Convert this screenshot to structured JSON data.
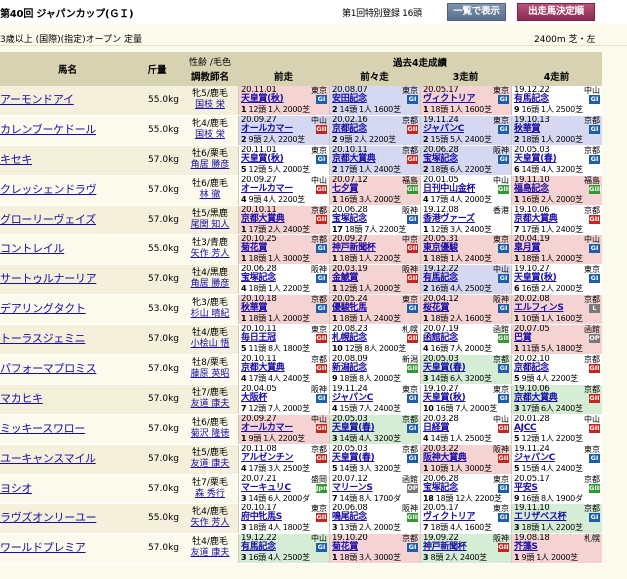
{
  "header": {
    "title": "第40回 ジャパンカップ(ＧＩ)",
    "registration": "第1回特別登録 16頭",
    "btn_list": "一覧で表示",
    "btn_entry": "出走馬決定順"
  },
  "conditions": "3歳以上 (国際)(指定)オープン 定量",
  "distance": "2400m 芝・左",
  "columns": {
    "name": "馬名",
    "weight": "斤量",
    "sex": "性齢 /毛色",
    "trainer": "調教師名",
    "past_header": "過去4走成績",
    "r1": "前走",
    "r2": "前々走",
    "r3": "3走前",
    "r4": "4走前"
  },
  "horses": [
    {
      "name": "アーモンドアイ",
      "weight": "55.0kg",
      "sex": "牝5/鹿毛",
      "trainer": "国枝 栄",
      "races": [
        {
          "date": "20.11.01",
          "venue": "東京",
          "race": "天皇賞(秋)",
          "grade": "GI",
          "gc": "1",
          "bg": "p",
          "info": "12頭 1人 2000芝",
          "pos": "1"
        },
        {
          "date": "20.08.07",
          "venue": "東京",
          "race": "安田記念",
          "grade": "GI",
          "gc": "1",
          "bg": "b",
          "info": "14頭 1人 1600芝",
          "pos": "2"
        },
        {
          "date": "20.05.17",
          "venue": "東京",
          "race": "ヴィクトリア",
          "grade": "GI",
          "gc": "1",
          "bg": "p",
          "info": "18頭 1人 1600芝",
          "pos": "1"
        },
        {
          "date": "19.12.22",
          "venue": "中山",
          "race": "有馬記念",
          "grade": "GI",
          "gc": "1",
          "bg": "w",
          "info": "16頭 1人 2500芝",
          "pos": "9"
        }
      ]
    },
    {
      "name": "カレンブーケドール",
      "weight": "55.0kg",
      "sex": "牝4/鹿毛",
      "trainer": "国枝 栄",
      "races": [
        {
          "date": "20.09.27",
          "venue": "中山",
          "race": "オールカマー",
          "grade": "GII",
          "gc": "2",
          "bg": "b",
          "info": "9頭 2人 2200芝",
          "pos": "2"
        },
        {
          "date": "20.02.16",
          "venue": "京都",
          "race": "京都記念",
          "grade": "GII",
          "gc": "2",
          "bg": "b",
          "info": "9頭 2人 2200芝",
          "pos": "2"
        },
        {
          "date": "19.11.24",
          "venue": "東京",
          "race": "ジャパンC",
          "grade": "GI",
          "gc": "1",
          "bg": "b",
          "info": "15頭 5人 2400芝",
          "pos": "2"
        },
        {
          "date": "19.10.13",
          "venue": "京都",
          "race": "秋華賞",
          "grade": "GI",
          "gc": "1",
          "bg": "b",
          "info": "18頭 1人 2000芝",
          "pos": "2"
        }
      ]
    },
    {
      "name": "キセキ",
      "weight": "57.0kg",
      "sex": "牡6/栗毛",
      "trainer": "角居 勝彦",
      "races": [
        {
          "date": "20.11.01",
          "venue": "東京",
          "race": "天皇賞(秋)",
          "grade": "GI",
          "gc": "1",
          "bg": "w",
          "info": "12頭 5人 2000芝",
          "pos": "5"
        },
        {
          "date": "20.10.11",
          "venue": "京都",
          "race": "京都大賞典",
          "grade": "GII",
          "gc": "2",
          "bg": "b",
          "info": "17頭 1人 2400芝",
          "pos": "2"
        },
        {
          "date": "20.06.28",
          "venue": "阪神",
          "race": "宝塚記念",
          "grade": "GI",
          "gc": "1",
          "bg": "b",
          "info": "18頭 6人 2200芝",
          "pos": "2"
        },
        {
          "date": "20.05.03",
          "venue": "京都",
          "race": "天皇賞(春)",
          "grade": "GI",
          "gc": "1",
          "bg": "w",
          "info": "14頭 4人 3200芝",
          "pos": "6"
        }
      ]
    },
    {
      "name": "クレッシェンドラヴ",
      "weight": "57.0kg",
      "sex": "牡6/鹿毛",
      "trainer": "林 徹",
      "races": [
        {
          "date": "20.09.27",
          "venue": "中山",
          "race": "オールカマー",
          "grade": "GII",
          "gc": "2",
          "bg": "w",
          "info": "9頭 4人 2200芝",
          "pos": "4"
        },
        {
          "date": "20.07.12",
          "venue": "福島",
          "race": "七夕賞",
          "grade": "GIII",
          "gc": "3",
          "bg": "p",
          "info": "16頭 3人 2000芝",
          "pos": "1"
        },
        {
          "date": "20.01.05",
          "venue": "中山",
          "race": "日刊中山金杯",
          "grade": "GIII",
          "gc": "3",
          "bg": "w",
          "info": "17頭 4人 2000芝",
          "pos": "4"
        },
        {
          "date": "19.11.10",
          "venue": "福島",
          "race": "福島記念",
          "grade": "GIII",
          "gc": "3",
          "bg": "p",
          "info": "16頭 2人 2000芝",
          "pos": "1"
        }
      ]
    },
    {
      "name": "グローリーヴェイズ",
      "weight": "57.0kg",
      "sex": "牡5/黒鹿",
      "trainer": "尾関 知人",
      "races": [
        {
          "date": "20.10.11",
          "venue": "京都",
          "race": "京都大賞典",
          "grade": "GII",
          "gc": "2",
          "bg": "p",
          "info": "17頭 2人 2400芝",
          "pos": "1"
        },
        {
          "date": "20.06.28",
          "venue": "阪神",
          "race": "宝塚記念",
          "grade": "GI",
          "gc": "1",
          "bg": "w",
          "info": "18頭 7人 2200芝",
          "pos": "17"
        },
        {
          "date": "19.12.08",
          "venue": "香港",
          "race": "香港ヴァーズ",
          "grade": "",
          "gc": "",
          "bg": "w",
          "info": "12頭 3人 2400芝",
          "pos": "1"
        },
        {
          "date": "19.10.06",
          "venue": "京都",
          "race": "京都大賞典",
          "grade": "GII",
          "gc": "2",
          "bg": "w",
          "info": "17頭 1人 2400芝",
          "pos": "7"
        }
      ]
    },
    {
      "name": "コントレイル",
      "weight": "55.0kg",
      "sex": "牡3/青鹿",
      "trainer": "矢作 芳人",
      "races": [
        {
          "date": "20.10.25",
          "venue": "京都",
          "race": "菊花賞",
          "grade": "GI",
          "gc": "1",
          "bg": "p",
          "info": "18頭 1人 3000芝",
          "pos": "1"
        },
        {
          "date": "20.09.27",
          "venue": "中京",
          "race": "神戸新聞杯",
          "grade": "GII",
          "gc": "2",
          "bg": "p",
          "info": "18頭 1人 2200芝",
          "pos": "1"
        },
        {
          "date": "20.05.31",
          "venue": "東京",
          "race": "東京優駿",
          "grade": "GI",
          "gc": "1",
          "bg": "p",
          "info": "18頭 1人 2400芝",
          "pos": "1"
        },
        {
          "date": "20.04.19",
          "venue": "中山",
          "race": "皐月賞",
          "grade": "GI",
          "gc": "1",
          "bg": "p",
          "info": "18頭 1人 2000芝",
          "pos": "1"
        }
      ]
    },
    {
      "name": "サートゥルナーリア",
      "weight": "57.0kg",
      "sex": "牡4/黒鹿",
      "trainer": "角居 勝彦",
      "races": [
        {
          "date": "20.06.28",
          "venue": "阪神",
          "race": "宝塚記念",
          "grade": "GI",
          "gc": "1",
          "bg": "w",
          "info": "18頭 1人 2200芝",
          "pos": "4"
        },
        {
          "date": "20.03.19",
          "venue": "阪神",
          "race": "金鯱賞",
          "grade": "GII",
          "gc": "2",
          "bg": "p",
          "info": "12頭 1人 2000芝",
          "pos": "1"
        },
        {
          "date": "19.12.22",
          "venue": "中山",
          "race": "有馬記念",
          "grade": "GI",
          "gc": "1",
          "bg": "b",
          "info": "16頭 4人 2500芝",
          "pos": "2"
        },
        {
          "date": "19.10.27",
          "venue": "東京",
          "race": "天皇賞(秋)",
          "grade": "GI",
          "gc": "1",
          "bg": "w",
          "info": "16頭 2人 2000芝",
          "pos": "6"
        }
      ]
    },
    {
      "name": "デアリングタクト",
      "weight": "53.0kg",
      "sex": "牝3/鹿毛",
      "trainer": "杉山 晴紀",
      "races": [
        {
          "date": "20.10.18",
          "venue": "京都",
          "race": "秋華賞",
          "grade": "GI",
          "gc": "1",
          "bg": "p",
          "info": "18頭 1人 2000芝",
          "pos": "1"
        },
        {
          "date": "20.05.24",
          "venue": "東京",
          "race": "優駿牝馬",
          "grade": "GI",
          "gc": "1",
          "bg": "p",
          "info": "18頭 1人 2400芝",
          "pos": "1"
        },
        {
          "date": "20.04.12",
          "venue": "阪神",
          "race": "桜花賞",
          "grade": "GI",
          "gc": "1",
          "bg": "p",
          "info": "18頭 2人 1600芝",
          "pos": "1"
        },
        {
          "date": "20.02.08",
          "venue": "京都",
          "race": "エルフィンS",
          "grade": "L",
          "gc": "l",
          "bg": "p",
          "info": "10頭 1人 1600芝",
          "pos": "1"
        }
      ]
    },
    {
      "name": "トーラスジェミニ",
      "weight": "57.0kg",
      "sex": "牡4/鹿毛",
      "trainer": "小桧山 悟",
      "races": [
        {
          "date": "20.10.11",
          "venue": "東京",
          "race": "毎日王冠",
          "grade": "GII",
          "gc": "2",
          "bg": "w",
          "info": "11頭 8人 1800芝",
          "pos": "5"
        },
        {
          "date": "20.08.23",
          "venue": "札幌",
          "race": "札幌記念",
          "grade": "GII",
          "gc": "2",
          "bg": "w",
          "info": "12頭 8人 2000芝",
          "pos": "10"
        },
        {
          "date": "20.07.19",
          "venue": "函館",
          "race": "函館記念",
          "grade": "GIII",
          "gc": "3",
          "bg": "w",
          "info": "16頭 7人 2000芝",
          "pos": "4"
        },
        {
          "date": "20.07.05",
          "venue": "函館",
          "race": "巴賞",
          "grade": "OP",
          "gc": "l",
          "bg": "p",
          "info": "11頭 5人 1800芝",
          "pos": "1"
        }
      ]
    },
    {
      "name": "パフォーマプロミス",
      "weight": "57.0kg",
      "sex": "牡8/栗毛",
      "trainer": "藤原 英昭",
      "races": [
        {
          "date": "20.10.11",
          "venue": "京都",
          "race": "京都大賞典",
          "grade": "GII",
          "gc": "2",
          "bg": "w",
          "info": "17頭 4人 2400芝",
          "pos": "4"
        },
        {
          "date": "20.08.09",
          "venue": "新潟",
          "race": "新潟記念",
          "grade": "GIII",
          "gc": "3",
          "bg": "w",
          "info": "18頭 8人 2000芝",
          "pos": "9"
        },
        {
          "date": "20.05.03",
          "venue": "京都",
          "race": "天皇賞(春)",
          "grade": "GI",
          "gc": "1",
          "bg": "g",
          "info": "14頭 6人 3200芝",
          "pos": "3"
        },
        {
          "date": "20.02.10",
          "venue": "京都",
          "race": "京都記念",
          "grade": "GII",
          "gc": "2",
          "bg": "w",
          "info": "9頭 4人 2200芝",
          "pos": "5"
        }
      ]
    },
    {
      "name": "マカヒキ",
      "weight": "57.0kg",
      "sex": "牡7/鹿毛",
      "trainer": "友道 康夫",
      "races": [
        {
          "date": "20.04.05",
          "venue": "阪神",
          "race": "大阪杯",
          "grade": "GI",
          "gc": "1",
          "bg": "w",
          "info": "12頭 7人 2000芝",
          "pos": "7"
        },
        {
          "date": "19.11.24",
          "venue": "東京",
          "race": "ジャパンC",
          "grade": "GI",
          "gc": "1",
          "bg": "w",
          "info": "15頭 7人 2400芝",
          "pos": "4"
        },
        {
          "date": "19.10.27",
          "venue": "東京",
          "race": "天皇賞(秋)",
          "grade": "GI",
          "gc": "1",
          "bg": "w",
          "info": "16頭 7人 2000芝",
          "pos": "10"
        },
        {
          "date": "19.10.06",
          "venue": "京都",
          "race": "京都大賞典",
          "grade": "GII",
          "gc": "2",
          "bg": "g",
          "info": "17頭 6人 2400芝",
          "pos": "3"
        }
      ]
    },
    {
      "name": "ミッキースワロー",
      "weight": "57.0kg",
      "sex": "牡6/鹿毛",
      "trainer": "菊沢 隆徳",
      "races": [
        {
          "date": "20.09.27",
          "venue": "中山",
          "race": "オールカマー",
          "grade": "GII",
          "gc": "2",
          "bg": "p",
          "info": "9頭 1人 2200芝",
          "pos": "1"
        },
        {
          "date": "20.05.03",
          "venue": "京都",
          "race": "天皇賞(春)",
          "grade": "GI",
          "gc": "1",
          "bg": "g",
          "info": "14頭 4人 3200芝",
          "pos": "3"
        },
        {
          "date": "20.03.28",
          "venue": "中山",
          "race": "日経賞",
          "grade": "GII",
          "gc": "2",
          "bg": "w",
          "info": "14頭 1人 2500芝",
          "pos": "4"
        },
        {
          "date": "20.01.28",
          "venue": "中山",
          "race": "AJCC",
          "grade": "GII",
          "gc": "2",
          "bg": "w",
          "info": "12頭 1人 2200芝",
          "pos": "5"
        }
      ]
    },
    {
      "name": "ユーキャンスマイル",
      "weight": "57.0kg",
      "sex": "牡5/鹿毛",
      "trainer": "友道 康夫",
      "races": [
        {
          "date": "20.11.08",
          "venue": "京都",
          "race": "アルゼンチン",
          "grade": "GII",
          "gc": "2",
          "bg": "w",
          "info": "17頭 3人 2500芝",
          "pos": "4"
        },
        {
          "date": "20.05.03",
          "venue": "京都",
          "race": "天皇賞(春)",
          "grade": "GI",
          "gc": "1",
          "bg": "w",
          "info": "14頭 3人 3200芝",
          "pos": "5"
        },
        {
          "date": "20.03.22",
          "venue": "阪神",
          "race": "阪神大賞典",
          "grade": "GII",
          "gc": "2",
          "bg": "p",
          "info": "10頭 1人 3000芝",
          "pos": "1"
        },
        {
          "date": "19.11.24",
          "venue": "東京",
          "race": "ジャパンC",
          "grade": "GI",
          "gc": "1",
          "bg": "w",
          "info": "15頭 4人 2400芝",
          "pos": "5"
        }
      ]
    },
    {
      "name": "ヨシオ",
      "weight": "57.0kg",
      "sex": "牡7/栗毛",
      "trainer": "森 秀行",
      "races": [
        {
          "date": "20.07.21",
          "venue": "盛岡",
          "race": "マーキュリC",
          "grade": "JpnIII",
          "gc": "3",
          "bg": "w",
          "info": "14頭 6人 2000ダ",
          "pos": "3"
        },
        {
          "date": "20.07.12",
          "venue": "函館",
          "race": "マリーンS",
          "grade": "OP",
          "gc": "l",
          "bg": "w",
          "info": "14頭 8人 1700ダ",
          "pos": "7"
        },
        {
          "date": "20.06.28",
          "venue": "東京",
          "race": "宝塚記念",
          "grade": "GI",
          "gc": "1",
          "bg": "w",
          "info": "18頭 12人 2200芝",
          "pos": "18"
        },
        {
          "date": "20.05.17",
          "venue": "京都",
          "race": "平安S",
          "grade": "GIII",
          "gc": "3",
          "bg": "w",
          "info": "16頭 8人 1900ダ",
          "pos": "9"
        }
      ]
    },
    {
      "name": "ラヴズオンリーユー",
      "weight": "55.0kg",
      "sex": "牝4/鹿毛",
      "trainer": "矢作 芳人",
      "races": [
        {
          "date": "20.10.17",
          "venue": "東京",
          "race": "府中牝馬S",
          "grade": "GII",
          "gc": "2",
          "bg": "w",
          "info": "18頭 4人 1800芝",
          "pos": "3"
        },
        {
          "date": "20.06.08",
          "venue": "阪神",
          "race": "鳴尾記念",
          "grade": "GIII",
          "gc": "3",
          "bg": "w",
          "info": "13頭 2人 2000芝",
          "pos": "3"
        },
        {
          "date": "20.05.17",
          "venue": "東京",
          "race": "ヴィクトリア",
          "grade": "GI",
          "gc": "1",
          "bg": "w",
          "info": "18頭 4人 1600芝",
          "pos": "7"
        },
        {
          "date": "19.11.10",
          "venue": "京都",
          "race": "エリザベス杯",
          "grade": "GI",
          "gc": "1",
          "bg": "g",
          "info": "18頭 1人 2200芝",
          "pos": "3"
        }
      ]
    },
    {
      "name": "ワールドプレミア",
      "weight": "57.0kg",
      "sex": "牡4/鹿毛",
      "trainer": "友道 康夫",
      "races": [
        {
          "date": "19.12.22",
          "venue": "中山",
          "race": "有馬記念",
          "grade": "GI",
          "gc": "1",
          "bg": "g",
          "info": "16頭 4人 2500芝",
          "pos": "3"
        },
        {
          "date": "19.10.20",
          "venue": "京都",
          "race": "菊花賞",
          "grade": "GI",
          "gc": "1",
          "bg": "p",
          "info": "18頭 3人 3000芝",
          "pos": "1"
        },
        {
          "date": "19.09.22",
          "venue": "阪神",
          "race": "神戸新聞杯",
          "grade": "GII",
          "gc": "2",
          "bg": "g",
          "info": "8頭 2人 2400芝",
          "pos": "3"
        },
        {
          "date": "19.08.18",
          "venue": "札幌",
          "race": "芥藻S",
          "grade": "",
          "gc": "",
          "bg": "p",
          "info": "9頭 1人 2000芝",
          "pos": "1"
        }
      ]
    }
  ]
}
